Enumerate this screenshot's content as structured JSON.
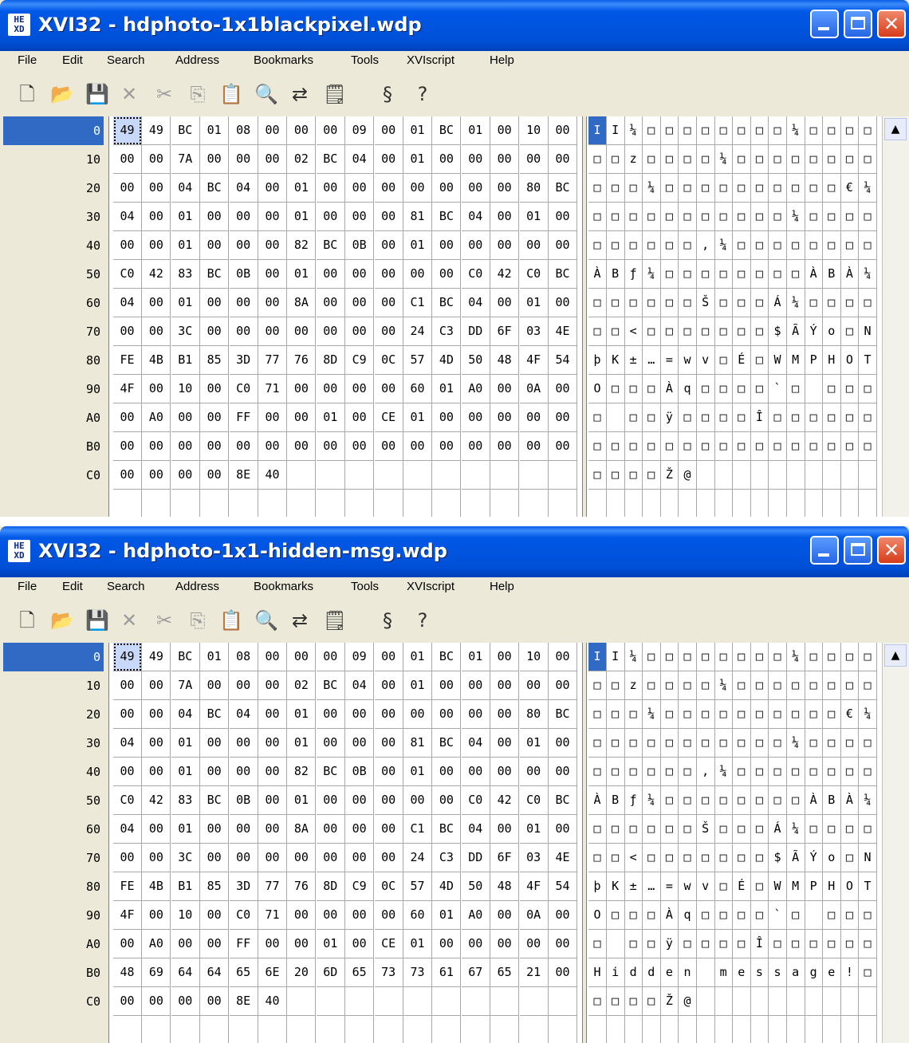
{
  "windows": [
    {
      "app_icon": "hex-app-icon",
      "title": "XVI32 - hdphoto-1x1blackpixel.wdp",
      "menu": [
        "File",
        "Edit",
        "Search",
        "Address",
        "Bookmarks",
        "Tools",
        "XVIscript",
        "Help"
      ],
      "toolbar_icons": [
        "new-file-icon",
        "open-folder-icon",
        "save-icon",
        "delete-x-icon",
        "cut-icon",
        "copy-icon",
        "paste-icon",
        "find-icon",
        "replace-icon",
        "properties-icon",
        "script-icon",
        "help-pointer-icon"
      ],
      "addresses": [
        "0",
        "10",
        "20",
        "30",
        "40",
        "50",
        "60",
        "70",
        "80",
        "90",
        "A0",
        "B0",
        "C0",
        ""
      ],
      "hex_rows": [
        [
          "49",
          "49",
          "BC",
          "01",
          "08",
          "00",
          "00",
          "00",
          "09",
          "00",
          "01",
          "BC",
          "01",
          "00",
          "10",
          "00"
        ],
        [
          "00",
          "00",
          "7A",
          "00",
          "00",
          "00",
          "02",
          "BC",
          "04",
          "00",
          "01",
          "00",
          "00",
          "00",
          "00",
          "00"
        ],
        [
          "00",
          "00",
          "04",
          "BC",
          "04",
          "00",
          "01",
          "00",
          "00",
          "00",
          "00",
          "00",
          "00",
          "00",
          "80",
          "BC"
        ],
        [
          "04",
          "00",
          "01",
          "00",
          "00",
          "00",
          "01",
          "00",
          "00",
          "00",
          "81",
          "BC",
          "04",
          "00",
          "01",
          "00"
        ],
        [
          "00",
          "00",
          "01",
          "00",
          "00",
          "00",
          "82",
          "BC",
          "0B",
          "00",
          "01",
          "00",
          "00",
          "00",
          "00",
          "00"
        ],
        [
          "C0",
          "42",
          "83",
          "BC",
          "0B",
          "00",
          "01",
          "00",
          "00",
          "00",
          "00",
          "00",
          "C0",
          "42",
          "C0",
          "BC"
        ],
        [
          "04",
          "00",
          "01",
          "00",
          "00",
          "00",
          "8A",
          "00",
          "00",
          "00",
          "C1",
          "BC",
          "04",
          "00",
          "01",
          "00"
        ],
        [
          "00",
          "00",
          "3C",
          "00",
          "00",
          "00",
          "00",
          "00",
          "00",
          "00",
          "24",
          "C3",
          "DD",
          "6F",
          "03",
          "4E"
        ],
        [
          "FE",
          "4B",
          "B1",
          "85",
          "3D",
          "77",
          "76",
          "8D",
          "C9",
          "0C",
          "57",
          "4D",
          "50",
          "48",
          "4F",
          "54"
        ],
        [
          "4F",
          "00",
          "10",
          "00",
          "C0",
          "71",
          "00",
          "00",
          "00",
          "00",
          "60",
          "01",
          "A0",
          "00",
          "0A",
          "00"
        ],
        [
          "00",
          "A0",
          "00",
          "00",
          "FF",
          "00",
          "00",
          "01",
          "00",
          "CE",
          "01",
          "00",
          "00",
          "00",
          "00",
          "00"
        ],
        [
          "00",
          "00",
          "00",
          "00",
          "00",
          "00",
          "00",
          "00",
          "00",
          "00",
          "00",
          "00",
          "00",
          "00",
          "00",
          "00"
        ],
        [
          "00",
          "00",
          "00",
          "00",
          "8E",
          "40"
        ]
      ],
      "ascii_rows": [
        [
          "I",
          "I",
          "¼",
          "□",
          "□",
          "□",
          "□",
          "□",
          "□",
          "□",
          "□",
          "¼",
          "□",
          "□",
          "□",
          "□"
        ],
        [
          "□",
          "□",
          "z",
          "□",
          "□",
          "□",
          "□",
          "¼",
          "□",
          "□",
          "□",
          "□",
          "□",
          "□",
          "□",
          "□"
        ],
        [
          "□",
          "□",
          "□",
          "¼",
          "□",
          "□",
          "□",
          "□",
          "□",
          "□",
          "□",
          "□",
          "□",
          "□",
          "€",
          "¼"
        ],
        [
          "□",
          "□",
          "□",
          "□",
          "□",
          "□",
          "□",
          "□",
          "□",
          "□",
          "□",
          "¼",
          "□",
          "□",
          "□",
          "□"
        ],
        [
          "□",
          "□",
          "□",
          "□",
          "□",
          "□",
          "‚",
          "¼",
          "□",
          "□",
          "□",
          "□",
          "□",
          "□",
          "□",
          "□"
        ],
        [
          "À",
          "B",
          "ƒ",
          "¼",
          "□",
          "□",
          "□",
          "□",
          "□",
          "□",
          "□",
          "□",
          "À",
          "B",
          "À",
          "¼"
        ],
        [
          "□",
          "□",
          "□",
          "□",
          "□",
          "□",
          "Š",
          "□",
          "□",
          "□",
          "Á",
          "¼",
          "□",
          "□",
          "□",
          "□"
        ],
        [
          "□",
          "□",
          "<",
          "□",
          "□",
          "□",
          "□",
          "□",
          "□",
          "□",
          "$",
          "Ã",
          "Ý",
          "o",
          "□",
          "N"
        ],
        [
          "þ",
          "K",
          "±",
          "…",
          "=",
          "w",
          "v",
          "□",
          "É",
          "□",
          "W",
          "M",
          "P",
          "H",
          "O",
          "T"
        ],
        [
          "O",
          "□",
          "□",
          "□",
          "À",
          "q",
          "□",
          "□",
          "□",
          "□",
          "`",
          "□",
          " ",
          "□",
          "□",
          "□"
        ],
        [
          "□",
          " ",
          "□",
          "□",
          "ÿ",
          "□",
          "□",
          "□",
          "□",
          "Î",
          "□",
          "□",
          "□",
          "□",
          "□",
          "□"
        ],
        [
          "□",
          "□",
          "□",
          "□",
          "□",
          "□",
          "□",
          "□",
          "□",
          "□",
          "□",
          "□",
          "□",
          "□",
          "□",
          "□"
        ],
        [
          "□",
          "□",
          "□",
          "□",
          "Ž",
          "@"
        ]
      ]
    },
    {
      "app_icon": "hex-app-icon",
      "title": "XVI32 - hdphoto-1x1-hidden-msg.wdp",
      "menu": [
        "File",
        "Edit",
        "Search",
        "Address",
        "Bookmarks",
        "Tools",
        "XVIscript",
        "Help"
      ],
      "toolbar_icons": [
        "new-file-icon",
        "open-folder-icon",
        "save-icon",
        "delete-x-icon",
        "cut-icon",
        "copy-icon",
        "paste-icon",
        "find-icon",
        "replace-icon",
        "properties-icon",
        "script-icon",
        "help-pointer-icon"
      ],
      "addresses": [
        "0",
        "10",
        "20",
        "30",
        "40",
        "50",
        "60",
        "70",
        "80",
        "90",
        "A0",
        "B0",
        "C0",
        ""
      ],
      "hex_rows": [
        [
          "49",
          "49",
          "BC",
          "01",
          "08",
          "00",
          "00",
          "00",
          "09",
          "00",
          "01",
          "BC",
          "01",
          "00",
          "10",
          "00"
        ],
        [
          "00",
          "00",
          "7A",
          "00",
          "00",
          "00",
          "02",
          "BC",
          "04",
          "00",
          "01",
          "00",
          "00",
          "00",
          "00",
          "00"
        ],
        [
          "00",
          "00",
          "04",
          "BC",
          "04",
          "00",
          "01",
          "00",
          "00",
          "00",
          "00",
          "00",
          "00",
          "00",
          "80",
          "BC"
        ],
        [
          "04",
          "00",
          "01",
          "00",
          "00",
          "00",
          "01",
          "00",
          "00",
          "00",
          "81",
          "BC",
          "04",
          "00",
          "01",
          "00"
        ],
        [
          "00",
          "00",
          "01",
          "00",
          "00",
          "00",
          "82",
          "BC",
          "0B",
          "00",
          "01",
          "00",
          "00",
          "00",
          "00",
          "00"
        ],
        [
          "C0",
          "42",
          "83",
          "BC",
          "0B",
          "00",
          "01",
          "00",
          "00",
          "00",
          "00",
          "00",
          "C0",
          "42",
          "C0",
          "BC"
        ],
        [
          "04",
          "00",
          "01",
          "00",
          "00",
          "00",
          "8A",
          "00",
          "00",
          "00",
          "C1",
          "BC",
          "04",
          "00",
          "01",
          "00"
        ],
        [
          "00",
          "00",
          "3C",
          "00",
          "00",
          "00",
          "00",
          "00",
          "00",
          "00",
          "24",
          "C3",
          "DD",
          "6F",
          "03",
          "4E"
        ],
        [
          "FE",
          "4B",
          "B1",
          "85",
          "3D",
          "77",
          "76",
          "8D",
          "C9",
          "0C",
          "57",
          "4D",
          "50",
          "48",
          "4F",
          "54"
        ],
        [
          "4F",
          "00",
          "10",
          "00",
          "C0",
          "71",
          "00",
          "00",
          "00",
          "00",
          "60",
          "01",
          "A0",
          "00",
          "0A",
          "00"
        ],
        [
          "00",
          "A0",
          "00",
          "00",
          "FF",
          "00",
          "00",
          "01",
          "00",
          "CE",
          "01",
          "00",
          "00",
          "00",
          "00",
          "00"
        ],
        [
          "48",
          "69",
          "64",
          "64",
          "65",
          "6E",
          "20",
          "6D",
          "65",
          "73",
          "73",
          "61",
          "67",
          "65",
          "21",
          "00"
        ],
        [
          "00",
          "00",
          "00",
          "00",
          "8E",
          "40"
        ]
      ],
      "ascii_rows": [
        [
          "I",
          "I",
          "¼",
          "□",
          "□",
          "□",
          "□",
          "□",
          "□",
          "□",
          "□",
          "¼",
          "□",
          "□",
          "□",
          "□"
        ],
        [
          "□",
          "□",
          "z",
          "□",
          "□",
          "□",
          "□",
          "¼",
          "□",
          "□",
          "□",
          "□",
          "□",
          "□",
          "□",
          "□"
        ],
        [
          "□",
          "□",
          "□",
          "¼",
          "□",
          "□",
          "□",
          "□",
          "□",
          "□",
          "□",
          "□",
          "□",
          "□",
          "€",
          "¼"
        ],
        [
          "□",
          "□",
          "□",
          "□",
          "□",
          "□",
          "□",
          "□",
          "□",
          "□",
          "□",
          "¼",
          "□",
          "□",
          "□",
          "□"
        ],
        [
          "□",
          "□",
          "□",
          "□",
          "□",
          "□",
          "‚",
          "¼",
          "□",
          "□",
          "□",
          "□",
          "□",
          "□",
          "□",
          "□"
        ],
        [
          "À",
          "B",
          "ƒ",
          "¼",
          "□",
          "□",
          "□",
          "□",
          "□",
          "□",
          "□",
          "□",
          "À",
          "B",
          "À",
          "¼"
        ],
        [
          "□",
          "□",
          "□",
          "□",
          "□",
          "□",
          "Š",
          "□",
          "□",
          "□",
          "Á",
          "¼",
          "□",
          "□",
          "□",
          "□"
        ],
        [
          "□",
          "□",
          "<",
          "□",
          "□",
          "□",
          "□",
          "□",
          "□",
          "□",
          "$",
          "Ã",
          "Ý",
          "o",
          "□",
          "N"
        ],
        [
          "þ",
          "K",
          "±",
          "…",
          "=",
          "w",
          "v",
          "□",
          "É",
          "□",
          "W",
          "M",
          "P",
          "H",
          "O",
          "T"
        ],
        [
          "O",
          "□",
          "□",
          "□",
          "À",
          "q",
          "□",
          "□",
          "□",
          "□",
          "`",
          "□",
          " ",
          "□",
          "□",
          "□"
        ],
        [
          "□",
          " ",
          "□",
          "□",
          "ÿ",
          "□",
          "□",
          "□",
          "□",
          "Î",
          "□",
          "□",
          "□",
          "□",
          "□",
          "□"
        ],
        [
          "H",
          "i",
          "d",
          "d",
          "e",
          "n",
          " ",
          "m",
          "e",
          "s",
          "s",
          "a",
          "g",
          "e",
          "!",
          "□"
        ],
        [
          "□",
          "□",
          "□",
          "□",
          "Ž",
          "@"
        ]
      ]
    }
  ]
}
